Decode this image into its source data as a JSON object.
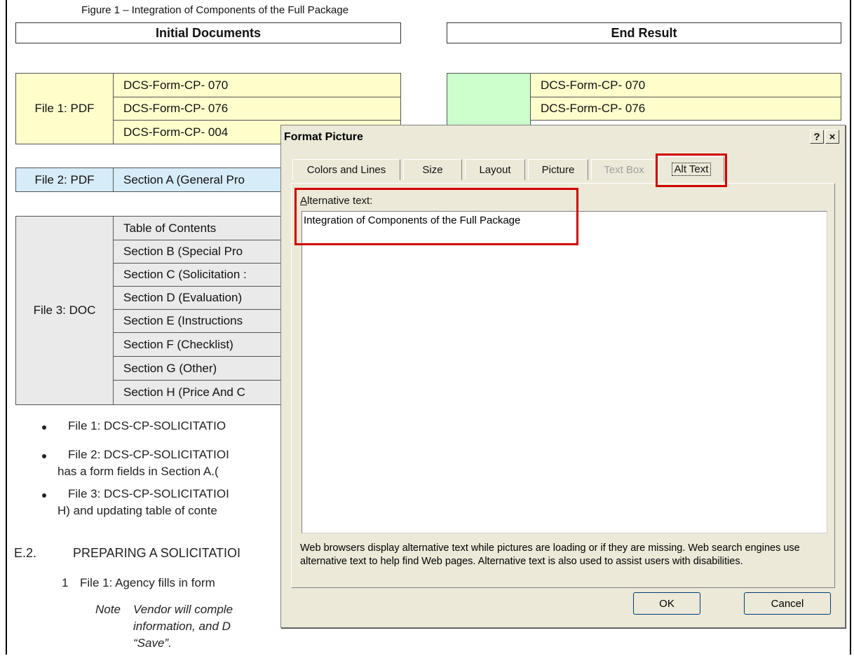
{
  "figure_caption": "Figure 1 – Integration of Components of the Full Package",
  "headers": {
    "initial": "Initial Documents",
    "end": "End Result"
  },
  "file1": {
    "label": "File 1: PDF",
    "rows": [
      "DCS-Form-CP- 070",
      "DCS-Form-CP- 076",
      "DCS-Form-CP- 004"
    ]
  },
  "end_result": {
    "rows": [
      "DCS-Form-CP- 070",
      "DCS-Form-CP- 076"
    ]
  },
  "file2": {
    "label": "File 2: PDF",
    "row": "Section A (General Pro"
  },
  "file3": {
    "label": "File 3: DOC",
    "rows": [
      "Table of Contents",
      "Section B (Special Pro",
      "Section C (Solicitation :",
      "Section D (Evaluation)",
      "Section E (Instructions",
      "Section F (Checklist)",
      "Section G (Other)",
      "Section H (Price And C"
    ]
  },
  "bullets": [
    {
      "lines": [
        "File 1:   DCS-CP-SOLICITATIO"
      ]
    },
    {
      "lines": [
        "File 2:   DCS-CP-SOLICITATIOI",
        "has a form fields in Section A.("
      ]
    },
    {
      "lines": [
        "File 3:   DCS-CP-SOLICITATIOI",
        "H) and updating table of conte"
      ]
    }
  ],
  "section": {
    "number": "E.2.",
    "title": "PREPARING A SOLICITATIOI"
  },
  "step": {
    "number": "1",
    "text": "File 1: Agency fills in form"
  },
  "note": {
    "label": "Note",
    "lines": [
      "Vendor  will  comple",
      "information,   and  D",
      "“Save”."
    ]
  },
  "dialog": {
    "title": "Format Picture",
    "help_button": "?",
    "close_button": "×",
    "tabs": [
      "Colors and Lines",
      "Size",
      "Layout",
      "Picture",
      "Text Box",
      "Alt Text"
    ],
    "active_tab": "Alt Text",
    "disabled_tab": "Text Box",
    "alt_label_rest": "lternative text:",
    "alt_label_accel": "A",
    "alt_text_value": "Integration of Components of the Full Package",
    "help_text": "Web browsers display alternative text while pictures are loading or if they are missing.  Web search engines use alternative text to help find Web pages.  Alternative text is also used to assist users with disabilities.",
    "ok_label": "OK",
    "cancel_label": "Cancel"
  },
  "colors": {
    "highlight": "#d00000",
    "yellow": "#ffffcc",
    "blue": "#d6ecf8",
    "gray": "#eaeaea",
    "green": "#ccffcc"
  }
}
